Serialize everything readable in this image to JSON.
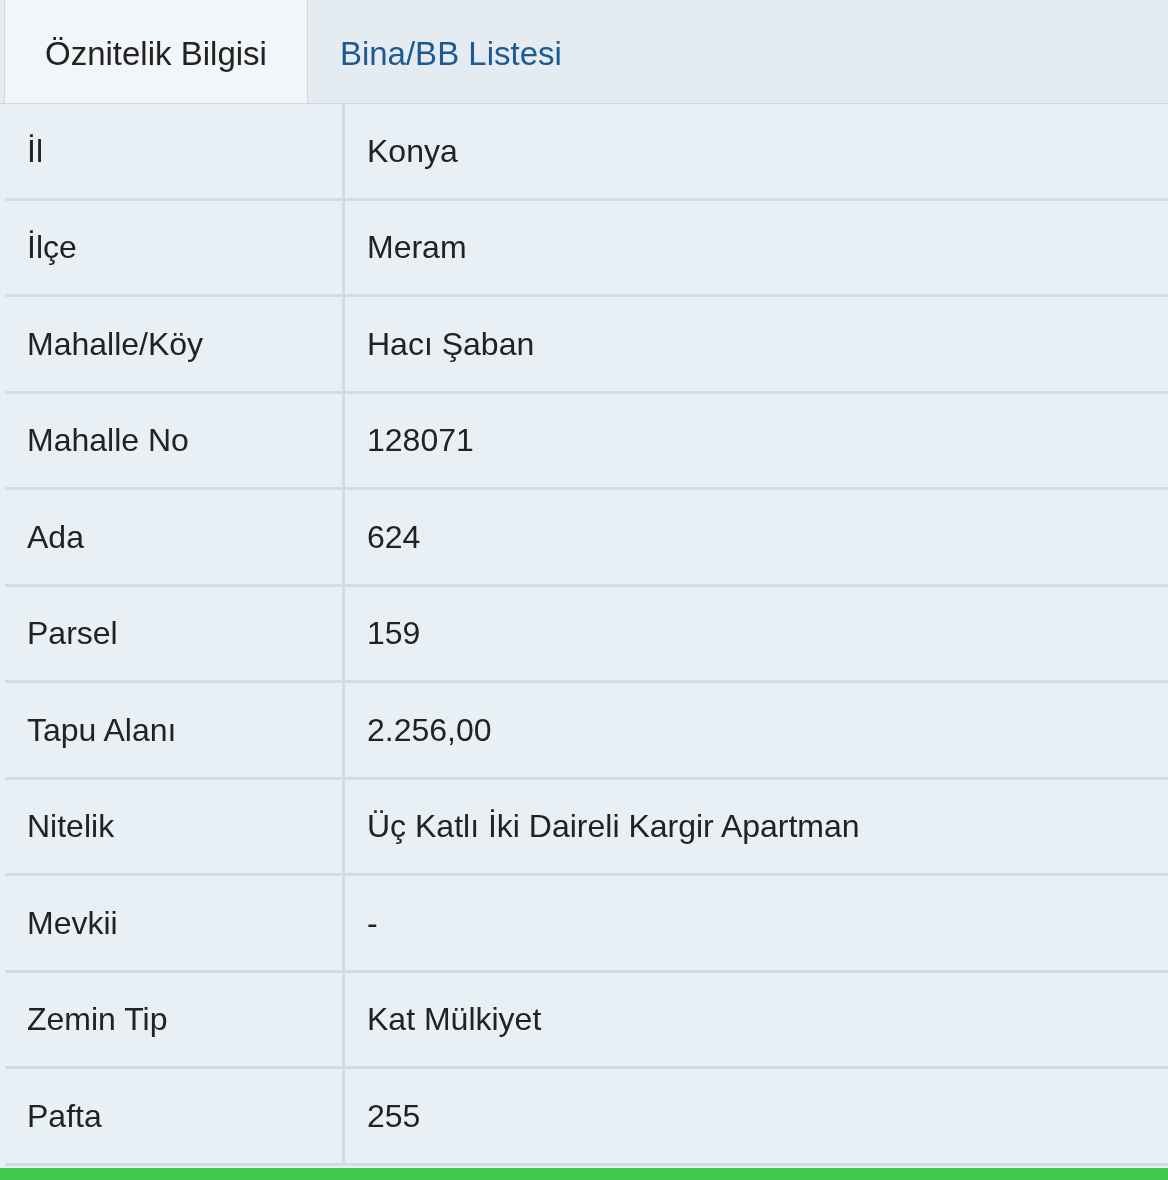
{
  "tabs": [
    {
      "label": "Öznitelik Bilgisi",
      "selected": true
    },
    {
      "label": "Bina/BB Listesi",
      "selected": false
    }
  ],
  "table": {
    "rows": [
      {
        "label": "İl",
        "value": "Konya"
      },
      {
        "label": "İlçe",
        "value": "Meram"
      },
      {
        "label": "Mahalle/Köy",
        "value": "Hacı Şaban"
      },
      {
        "label": "Mahalle No",
        "value": "128071"
      },
      {
        "label": "Ada",
        "value": "624"
      },
      {
        "label": "Parsel",
        "value": "159"
      },
      {
        "label": "Tapu Alanı",
        "value": "2.256,00"
      },
      {
        "label": "Nitelik",
        "value": "Üç Katlı İki Daireli Kargir Apartman"
      },
      {
        "label": "Mevkii",
        "value": "-"
      },
      {
        "label": "Zemin Tip",
        "value": "Kat Mülkiyet"
      },
      {
        "label": "Pafta",
        "value": "255"
      }
    ]
  }
}
